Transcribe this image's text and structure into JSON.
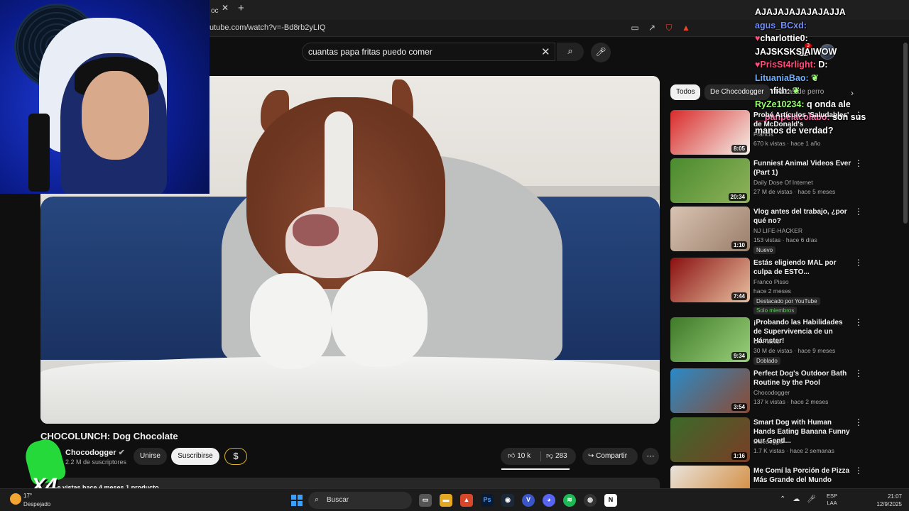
{
  "browser": {
    "tab_label": "oc",
    "url": "utube.com/watch?v=-Bd8rb2yLIQ"
  },
  "youtube": {
    "search_query": "cuantas papa fritas puedo comer",
    "notifications": "3"
  },
  "chat": [
    {
      "name": "",
      "msg": "AJAJAJAJAJAJAJJA"
    },
    {
      "name": "agus_BCxd:",
      "msg": ""
    },
    {
      "name": "charlottie0:",
      "msg": ""
    },
    {
      "name": "",
      "msg": "JAJSKSKSIAIWOW"
    },
    {
      "name": "PrisSt4rlight:",
      "msg": "D:"
    },
    {
      "name": "LituaniaBao:",
      "msg": ""
    },
    {
      "name": "namfith:",
      "msg": ""
    },
    {
      "name": "RyZe10234:",
      "msg": "q onda ale"
    },
    {
      "name": "__panpelacolabo:",
      "msg": "son sus"
    },
    {
      "name": "",
      "msg": "manos de verdad?"
    }
  ],
  "video": {
    "title": "CHOCOLUNCH: Dog Chocolate",
    "channel": "Chocodogger",
    "subscribers": "2.2 M de suscriptores",
    "join_label": "Unirse",
    "subscribe_label": "Suscribirse",
    "tip_label": "$",
    "likes": "10 k",
    "dislikes": "283",
    "share_label": "Compartir",
    "description_preview": "M de vistas  hace 4 meses  1 producto",
    "overlay_text": "X4"
  },
  "chips": {
    "all": "Todos",
    "channel": "De Chocodogger",
    "related": "Razas de perro"
  },
  "recommendations": [
    {
      "title": "Probé Artículos 'Saludables' de McDonald's",
      "channel": "Francis",
      "meta": "670 k vistas · hace 1 año",
      "duration": "8:05",
      "badge": "",
      "badge2": "",
      "colors": [
        "#d92b2b",
        "#f4f0e8"
      ]
    },
    {
      "title": "Funniest Animal Videos Ever (Part 1)",
      "channel": "Daily Dose Of Internet",
      "meta": "27 M de vistas · hace 5 meses",
      "duration": "20:34",
      "badge": "",
      "badge2": "",
      "colors": [
        "#4a8a2e",
        "#8fb35a"
      ]
    },
    {
      "title": "Vlog antes del trabajo, ¿por qué no?",
      "channel": "NJ LIFE-HACKER",
      "meta": "153 vistas · hace 6 días",
      "duration": "1:10",
      "badge": "Nuevo",
      "badge2": "",
      "colors": [
        "#d9c3b2",
        "#9a7e6a"
      ]
    },
    {
      "title": "Estás eligiendo MAL por culpa de ESTO...",
      "channel": "Franco Pisso",
      "meta": "hace 2 meses",
      "duration": "7:44",
      "badge": "Destacado por YouTube",
      "badge2": "Solo miembros",
      "colors": [
        "#8a1010",
        "#e8c0a0"
      ]
    },
    {
      "title": "¡Probando las Habilidades de Supervivencia de un Hámster!",
      "channel": "Dr. Plants",
      "meta": "30 M de vistas · hace 9 meses",
      "duration": "9:34",
      "badge": "Doblado",
      "badge2": "",
      "colors": [
        "#3f7a2a",
        "#9ad07a"
      ]
    },
    {
      "title": "Perfect Dog's Outdoor Bath Routine by the Pool",
      "channel": "Chocodogger",
      "meta": "137 k vistas · hace 2 meses",
      "duration": "3:54",
      "badge": "",
      "badge2": "",
      "colors": [
        "#2a8ac8",
        "#8c4a31"
      ]
    },
    {
      "title": "Smart Dog with Human Hands Eating Banana Funny our Gentl...",
      "channel": "Bluedogger",
      "meta": "1.7 K vistas · hace 2 semanas",
      "duration": "1:16",
      "badge": "",
      "badge2": "",
      "colors": [
        "#3b6a2a",
        "#7a3d26"
      ]
    },
    {
      "title": "Me Comí la Porción de Pizza Más Grande del Mundo",
      "channel": "",
      "meta": "",
      "duration": "",
      "badge": "",
      "badge2": "",
      "colors": [
        "#e9e4dc",
        "#d0802a"
      ]
    }
  ],
  "taskbar": {
    "temp": "17°",
    "weather": "Despejado",
    "search_label": "Buscar",
    "lang_top": "ESP",
    "lang_bottom": "LAA",
    "time": "21:07",
    "date": "12/9/2025"
  }
}
